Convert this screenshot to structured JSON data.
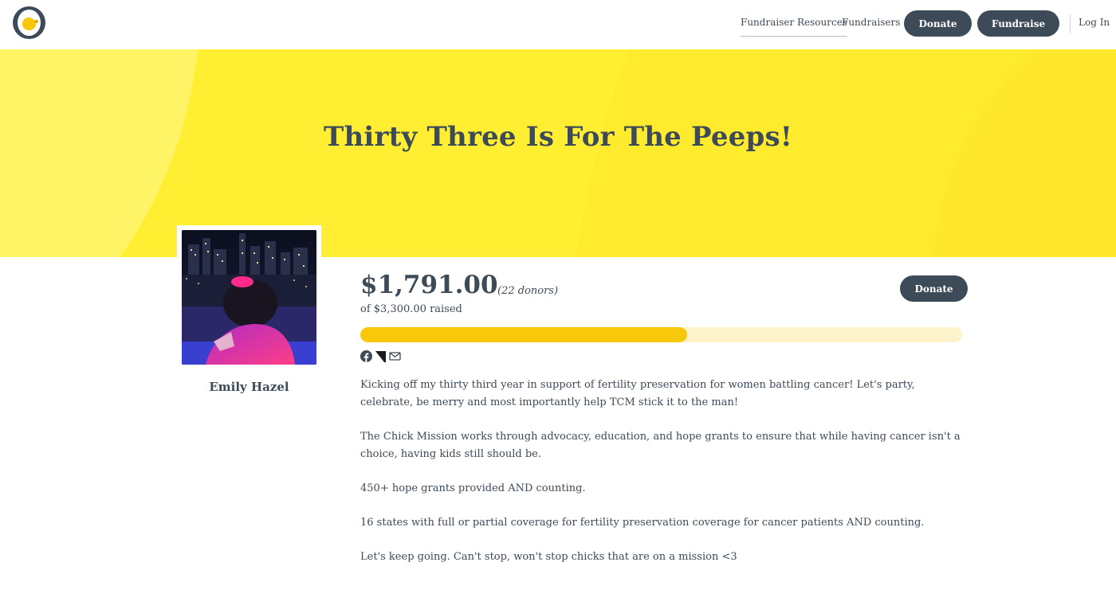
{
  "nav": {
    "resources": "Fundraiser Resources",
    "fundraisers": "Fundraisers",
    "donate": "Donate",
    "fundraise": "Fundraise",
    "login": "Log In",
    "logo_icon": "chick-logo-icon"
  },
  "hero": {
    "title": "Thirty Three Is For The Peeps!",
    "background": "#ffee32"
  },
  "profile": {
    "name": "Emily Hazel"
  },
  "stats": {
    "amount": "$1,791.00",
    "donors": "(22 donors)",
    "goal": "of $3,300.00 raised",
    "progress_fraction": 0.5427,
    "donate": "Donate"
  },
  "share": [
    "facebook-icon",
    "twitter-icon",
    "email-icon"
  ],
  "story": [
    "Kicking off my thirty third year in support of fertility preservation for women battling cancer! Let's party, celebrate, be merry and most importantly help TCM stick it to the man!",
    "The Chick Mission works through advocacy, education, and hope grants to ensure that while having cancer isn't a choice, having kids still should be.",
    "450+ hope grants provided AND counting.",
    "16 states with full or partial coverage for fertility preservation coverage for cancer patients AND counting.",
    "Let's keep going. Can't stop, won't stop chicks that are on a mission <3"
  ],
  "colors": {
    "primary": "#3d4a57",
    "accent": "#f8c80b",
    "progress_track": "#fff3cc"
  }
}
